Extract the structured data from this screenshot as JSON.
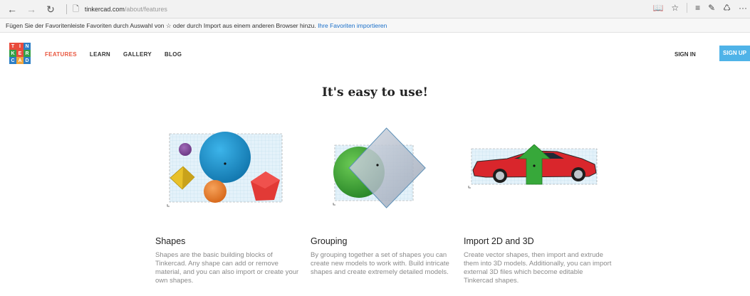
{
  "browser": {
    "url_host": "tinkercad.com",
    "url_path": "/about/features",
    "favorites_text": "Fügen Sie der Favoritenleiste Favoriten durch Auswahl von ☆ oder durch Import aus einem anderen Browser hinzu.",
    "favorites_link": "Ihre Favoriten importieren"
  },
  "logo": {
    "letters": [
      "T",
      "I",
      "N",
      "K",
      "E",
      "R",
      "C",
      "A",
      "D"
    ],
    "colors": [
      "#e94b3c",
      "#e94b3c",
      "#2c7ec5",
      "#35a047",
      "#e94b3c",
      "#35a047",
      "#2c7ec5",
      "#f2a43a",
      "#2c7ec5"
    ]
  },
  "nav": {
    "features": "FEATURES",
    "learn": "LEARN",
    "gallery": "GALLERY",
    "blog": "BLOG",
    "sign_in": "SIGN IN",
    "sign_up": "SIGN UP"
  },
  "headline": "It's easy to use!",
  "features": [
    {
      "title": "Shapes",
      "desc": "Shapes are the basic building blocks of Tinkercad. Any shape can add or remove material, and you can also import or create your own shapes."
    },
    {
      "title": "Grouping",
      "desc": "By grouping together a set of shapes you can create new models to work with. Build intricate shapes and create extremely detailed models."
    },
    {
      "title": "Import 2D and 3D",
      "desc": "Create vector shapes, then import and extrude them into 3D models. Additionally, you can import external 3D files which become editable Tinkercad shapes."
    }
  ],
  "colors": {
    "accent": "#e9573f",
    "signup_bg": "#4fb3e8",
    "link": "#1a6fc9"
  }
}
